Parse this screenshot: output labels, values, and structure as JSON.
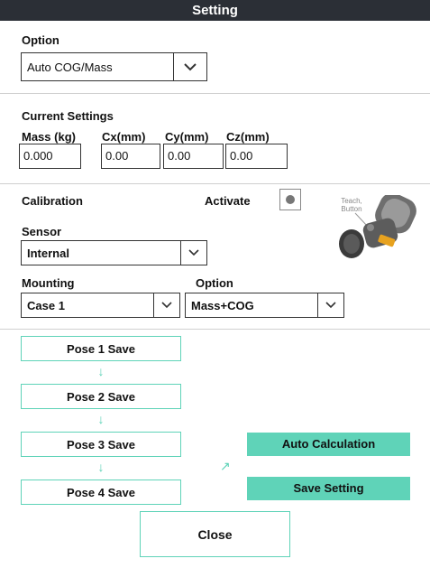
{
  "title": "Setting",
  "option": {
    "label": "Option",
    "selected": "Auto COG/Mass"
  },
  "current": {
    "label": "Current Settings",
    "fields": [
      {
        "label": "Mass  (kg)",
        "value": "0.000"
      },
      {
        "label": "Cx(mm)",
        "value": "0.00"
      },
      {
        "label": "Cy(mm)",
        "value": "0.00"
      },
      {
        "label": "Cz(mm)",
        "value": "0.00"
      }
    ]
  },
  "calibration": {
    "label": "Calibration",
    "activate_label": "Activate",
    "robot_caption": "Teach,\nButton",
    "sensor": {
      "label": "Sensor",
      "selected": "Internal"
    },
    "mounting": {
      "label": "Mounting",
      "selected": "Case 1"
    },
    "option": {
      "label": "Option",
      "selected": "Mass+COG"
    }
  },
  "poses": [
    "Pose 1 Save",
    "Pose 2 Save",
    "Pose 3 Save",
    "Pose 4 Save"
  ],
  "auto_calc_label": "Auto Calculation",
  "save_setting_label": "Save Setting",
  "close_label": "Close",
  "colors": {
    "accent": "#5fd3b8",
    "titlebar": "#2b2f36"
  }
}
